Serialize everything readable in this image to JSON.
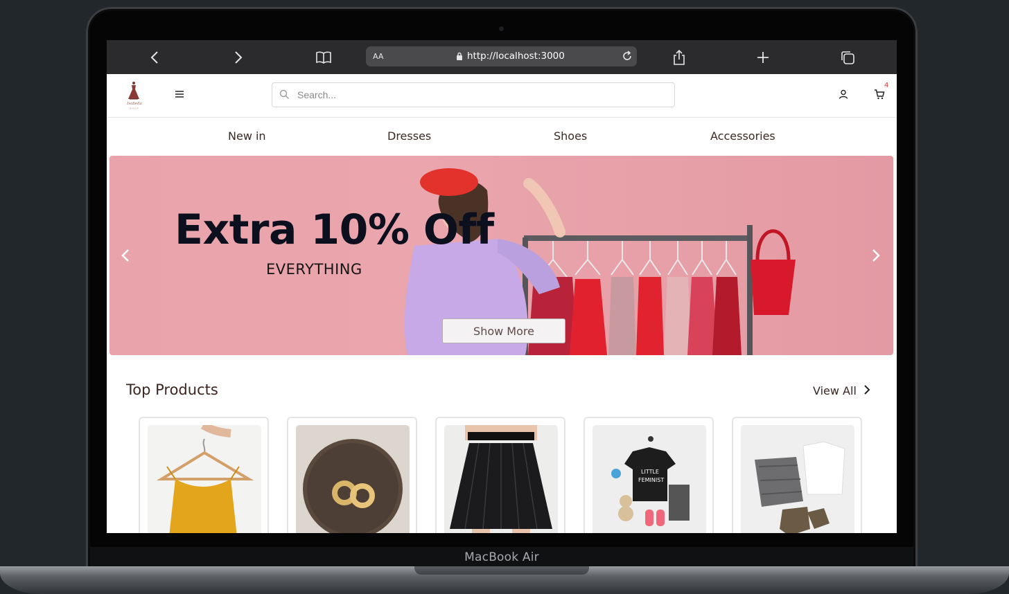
{
  "device": {
    "label": "MacBook Air"
  },
  "browser": {
    "text_size_label": "AA",
    "url": "http://localhost:3000"
  },
  "header": {
    "logo_text": "Isabella",
    "logo_subtext": "SHOP",
    "search_placeholder": "Search...",
    "cart_count": "4"
  },
  "categories": [
    "New in",
    "Dresses",
    "Shoes",
    "Accessories"
  ],
  "hero": {
    "title": "Extra 10% Off",
    "subtitle": "EVERYTHING",
    "button_label": "Show More"
  },
  "top_products": {
    "title": "Top Products",
    "view_all_label": "View All",
    "items": [
      {
        "image": "yellow-dress-on-hanger"
      },
      {
        "image": "gold-hoop-earrings"
      },
      {
        "image": "black-pleated-skirt"
      },
      {
        "image": "little-feminist-tshirt-outfit"
      },
      {
        "image": "jeans-white-tshirt-boots-outfit"
      }
    ]
  },
  "colors": {
    "hero_background": "#e9a3ab",
    "cart_badge": "#e53935",
    "text_brown": "#3a2520"
  }
}
